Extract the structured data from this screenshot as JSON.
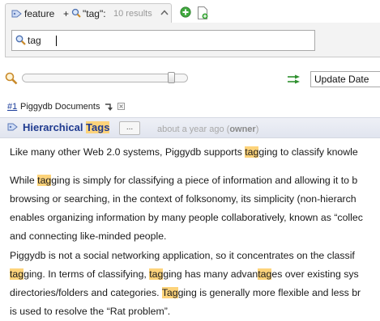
{
  "tabbar": {
    "active_tab": {
      "feature_label": "feature",
      "plus": "+",
      "query_label": "\"tag\":",
      "result_count": "10 results"
    }
  },
  "search": {
    "value": "tag"
  },
  "controls": {
    "zoom_level": 0.9,
    "sort_option": "Update Date"
  },
  "result_header": {
    "number": "#1",
    "title": "Piggydb Documents"
  },
  "fragment": {
    "title_before": "Hierarchical ",
    "title_highlight": "Tags",
    "more_label": "...",
    "meta_time": "about a year ago",
    "meta_open": " (",
    "meta_owner": "owner",
    "meta_close": ")"
  },
  "body": {
    "paragraphs": [
      {
        "lines": [
          [
            {
              "t": "Like many other Web 2.0 systems, Piggydb supports "
            },
            {
              "t": "tag",
              "h": true
            },
            {
              "t": "ging to classify knowle"
            }
          ]
        ]
      },
      {
        "lines": [
          [
            {
              "t": "While "
            },
            {
              "t": "tag",
              "h": true
            },
            {
              "t": "ging is simply for classifying a piece of information and allowing it to b"
            }
          ],
          [
            {
              "t": "browsing or searching, in the context of folksonomy, its simplicity (non-hierarch"
            }
          ],
          [
            {
              "t": "enables organizing information by many people collaboratively, known as “collec"
            }
          ],
          [
            {
              "t": "and connecting like-minded people."
            }
          ]
        ]
      },
      {
        "lines": [
          [
            {
              "t": "Piggydb is not a social networking application, so it concentrates on the classif"
            }
          ],
          [
            {
              "t": "tag",
              "h": true
            },
            {
              "t": "ging. In terms of classifying, "
            },
            {
              "t": "tag",
              "h": true
            },
            {
              "t": "ging has many advan"
            },
            {
              "t": "tag",
              "h": true
            },
            {
              "t": "es over existing sys"
            }
          ],
          [
            {
              "t": "directories/folders and categories. "
            },
            {
              "t": "Tag",
              "h": true
            },
            {
              "t": "ging is generally more flexible and less br"
            }
          ],
          [
            {
              "t": "is used to resolve the “Rat problem”."
            }
          ]
        ]
      }
    ]
  },
  "colors": {
    "link_blue": "#1f3a8f",
    "highlight": "#fdd37a",
    "header_bg": "#e1e5ef",
    "meta_gray": "#a8a8a8"
  },
  "icons": {
    "tab_icon": "tag-icon",
    "query_icon": "search-icon",
    "collapse_icon": "collapse-up-icon",
    "new_tab_icon": "green-plus-icon",
    "new_doc_icon": "new-document-icon",
    "zoom_icon": "magnifier-icon",
    "sort_direction_icon": "sort-direction-icon",
    "result_sort_icon": "sort-icon",
    "result_close_icon": "close-icon"
  }
}
